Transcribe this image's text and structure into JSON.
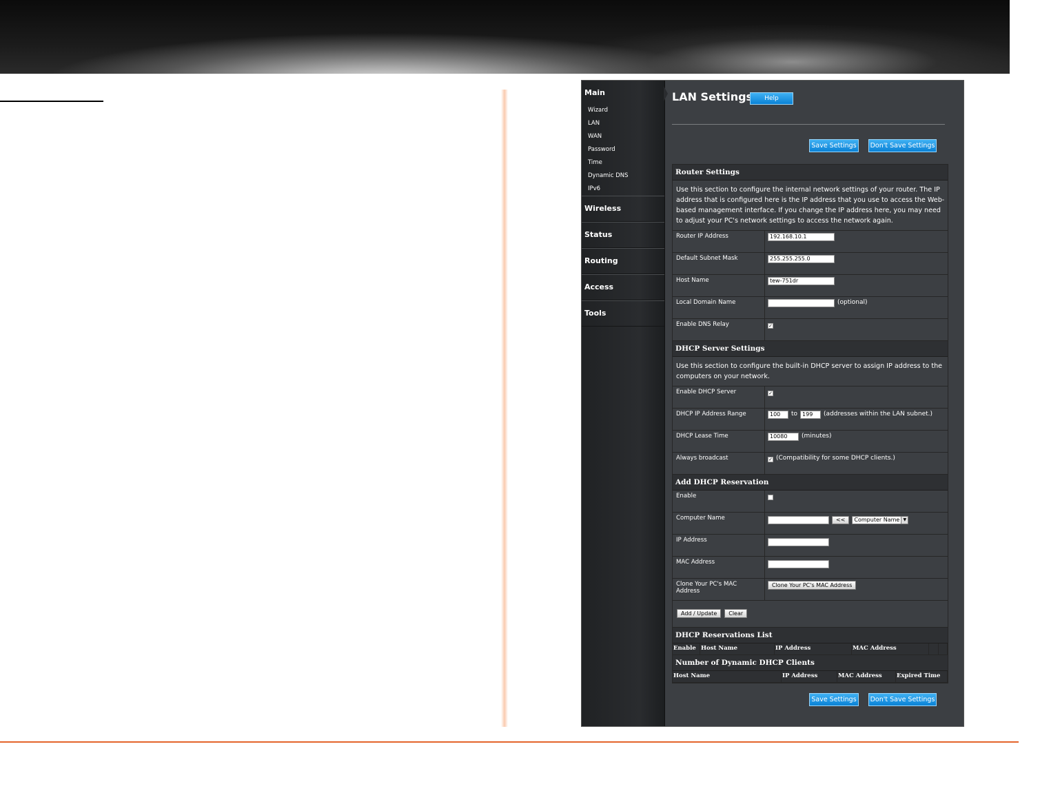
{
  "sidebar": {
    "main_label": "Main",
    "main_items": [
      "Wizard",
      "LAN",
      "WAN",
      "Password",
      "Time",
      "Dynamic DNS",
      "IPv6"
    ],
    "sections": [
      "Wireless",
      "Status",
      "Routing",
      "Access",
      "Tools"
    ]
  },
  "header": {
    "title": "LAN Settings",
    "help_label": "Help",
    "save_label": "Save Settings",
    "dont_save_label": "Don't Save Settings"
  },
  "router_settings": {
    "title": "Router Settings",
    "description": "Use this section to configure the internal network settings of your router. The IP address that is configured here is the IP address that you use to access the Web-based management interface. If you change the IP address here, you may need to adjust your PC's network settings to access the network again.",
    "router_ip_label": "Router IP Address",
    "router_ip_value": "192.168.10.1",
    "subnet_label": "Default Subnet Mask",
    "subnet_value": "255.255.255.0",
    "host_label": "Host Name",
    "host_value": "tew-751dr",
    "domain_label": "Local Domain Name",
    "domain_value": "",
    "domain_hint": "(optional)",
    "dns_relay_label": "Enable DNS Relay",
    "dns_relay_checked": true
  },
  "dhcp_server": {
    "title": "DHCP Server Settings",
    "description": "Use this section to configure the built-in DHCP server to assign IP address to the computers on your network.",
    "enable_label": "Enable DHCP Server",
    "enable_checked": true,
    "range_label": "DHCP IP Address Range",
    "range_start": "100",
    "range_to": "to",
    "range_end": "199",
    "range_hint": "(addresses within the LAN subnet.)",
    "lease_label": "DHCP Lease Time",
    "lease_value": "10080",
    "lease_hint": "(minutes)",
    "broadcast_label": "Always broadcast",
    "broadcast_checked": true,
    "broadcast_hint": "(Compatibility for some DHCP clients.)"
  },
  "reservation": {
    "title": "Add DHCP Reservation",
    "enable_label": "Enable",
    "enable_checked": false,
    "computer_label": "Computer Name",
    "computer_value": "",
    "copy_btn": "<<",
    "computer_select": "Computer Name",
    "ip_label": "IP Address",
    "ip_value": "",
    "mac_label": "MAC Address",
    "mac_value": "",
    "clone_label": "Clone Your PC's MAC Address",
    "clone_btn": "Clone Your PC's MAC Address",
    "add_btn": "Add / Update",
    "clear_btn": "Clear"
  },
  "reservations_list": {
    "title": "DHCP Reservations List",
    "columns": [
      "Enable",
      "Host Name",
      "IP Address",
      "MAC Address"
    ]
  },
  "dynamic_clients": {
    "title": "Number of Dynamic DHCP Clients",
    "columns": [
      "Host Name",
      "IP Address",
      "MAC Address",
      "Expired Time"
    ]
  }
}
